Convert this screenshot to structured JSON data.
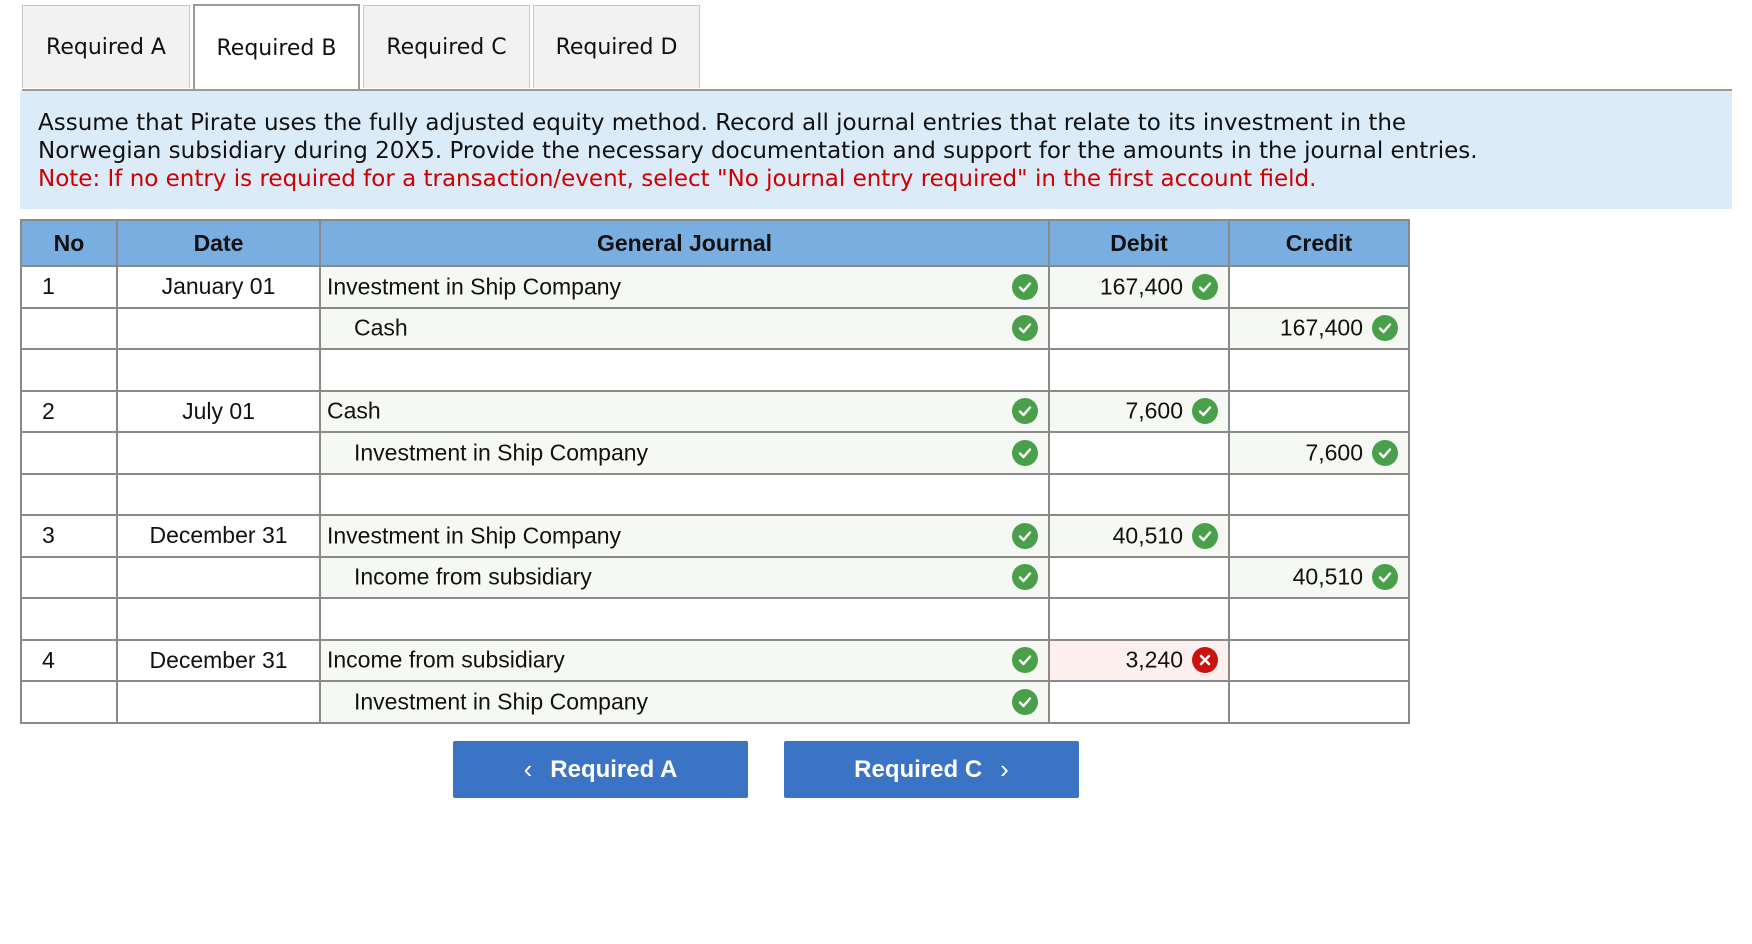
{
  "tabs": [
    {
      "label": "Required A"
    },
    {
      "label": "Required B"
    },
    {
      "label": "Required C"
    },
    {
      "label": "Required D"
    }
  ],
  "active_tab": "Required B",
  "instructions": {
    "line1": "Assume that Pirate uses the fully adjusted equity method. Record all journal entries that relate to its investment in the",
    "line2": "Norwegian subsidiary during 20X5. Provide the necessary documentation and support for the amounts in the journal entries.",
    "note": "Note: If no entry is required for a transaction/event, select \"No journal entry required\" in the first account field."
  },
  "journal": {
    "headers": {
      "no": "No",
      "date": "Date",
      "account": "General Journal",
      "debit": "Debit",
      "credit": "Credit"
    },
    "rows": [
      {
        "no": "1",
        "date": "January 01",
        "account": "Investment in Ship Company",
        "indent": false,
        "account_status": "correct",
        "debit": "167,400",
        "debit_status": "correct",
        "credit": "",
        "credit_status": ""
      },
      {
        "no": "",
        "date": "",
        "account": "Cash",
        "indent": true,
        "account_status": "correct",
        "debit": "",
        "debit_status": "",
        "credit": "167,400",
        "credit_status": "correct"
      },
      {
        "no": "",
        "date": "",
        "account": "",
        "indent": false,
        "account_status": "",
        "debit": "",
        "debit_status": "",
        "credit": "",
        "credit_status": ""
      },
      {
        "no": "2",
        "date": "July 01",
        "account": "Cash",
        "indent": false,
        "account_status": "correct",
        "debit": "7,600",
        "debit_status": "correct",
        "credit": "",
        "credit_status": ""
      },
      {
        "no": "",
        "date": "",
        "account": "Investment in Ship Company",
        "indent": true,
        "account_status": "correct",
        "debit": "",
        "debit_status": "",
        "credit": "7,600",
        "credit_status": "correct"
      },
      {
        "no": "",
        "date": "",
        "account": "",
        "indent": false,
        "account_status": "",
        "debit": "",
        "debit_status": "",
        "credit": "",
        "credit_status": ""
      },
      {
        "no": "3",
        "date": "December 31",
        "account": "Investment in Ship Company",
        "indent": false,
        "account_status": "correct",
        "debit": "40,510",
        "debit_status": "correct",
        "credit": "",
        "credit_status": ""
      },
      {
        "no": "",
        "date": "",
        "account": "Income from subsidiary",
        "indent": true,
        "account_status": "correct",
        "debit": "",
        "debit_status": "",
        "credit": "40,510",
        "credit_status": "correct"
      },
      {
        "no": "",
        "date": "",
        "account": "",
        "indent": false,
        "account_status": "",
        "debit": "",
        "debit_status": "",
        "credit": "",
        "credit_status": ""
      },
      {
        "no": "4",
        "date": "December 31",
        "account": "Income from subsidiary",
        "indent": false,
        "account_status": "correct",
        "debit": "3,240",
        "debit_status": "incorrect",
        "credit": "",
        "credit_status": ""
      },
      {
        "no": "",
        "date": "",
        "account": "Investment in Ship Company",
        "indent": true,
        "account_status": "correct",
        "debit": "",
        "debit_status": "",
        "credit": "",
        "credit_status": ""
      }
    ]
  },
  "nav": {
    "prev_label": "Required A",
    "prev_icon": "chevron-left-icon",
    "next_label": "Required C",
    "next_icon": "chevron-right-icon"
  },
  "colors": {
    "header_bg": "#7aaee0",
    "instructions_bg": "#dcebf8",
    "note": "#cc0000",
    "correct": "#4aa04a",
    "incorrect": "#cc1111",
    "button": "#3b74c4"
  }
}
